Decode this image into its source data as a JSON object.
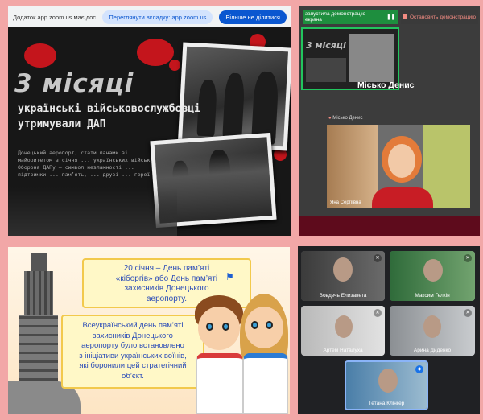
{
  "browser_bar": {
    "message": "Додаток app.zoom.us має доступ до цієї вкладки",
    "switch_button": "Переглянути вкладку: app.zoom.us",
    "stop_button": "Більше не ділитися"
  },
  "slide": {
    "headline": "3 місяці",
    "subtitle_line1": "українські військовослужбовці",
    "subtitle_line2": "утримували ДАП",
    "body": "Донецький аеропорт, стати панами зі майоритетом з січня ... українських військ. Оборона ДАПу — символ незламності ... підтримки ... пам’ять, ... друзі ... герої"
  },
  "zoom_share": {
    "share_label": "запустила демонстрацію екрана",
    "stop_label": "Остановить демонстрацию",
    "presenter_name": "Місько Денис",
    "tile_label": "Місько Денис",
    "participant_label": "Яна Сергіївна"
  },
  "poster": {
    "box1": [
      "20 січня – День пам’яті",
      "«кіборгів» або День пам’яті",
      "захисників Донецького",
      "аеропорту."
    ],
    "box2": [
      "Всеукраїнський день пам’яті",
      "захисників Донецького",
      "аеропорту було встановлено",
      "з ініціативи українських воїнів,",
      "які боронили цей стратегічний",
      "об’єкт."
    ]
  },
  "gallery": {
    "participants": [
      {
        "name": "Вовдечь Елизавета"
      },
      {
        "name": "Максим Гелкін"
      },
      {
        "name": "Артем Наталуха"
      },
      {
        "name": "Арина Диденко"
      },
      {
        "name": "Тетана Клінгер"
      }
    ]
  },
  "colors": {
    "background": "#f2a7a7",
    "share_green": "#1e8e3e",
    "accent_blue": "#0b57d0"
  }
}
